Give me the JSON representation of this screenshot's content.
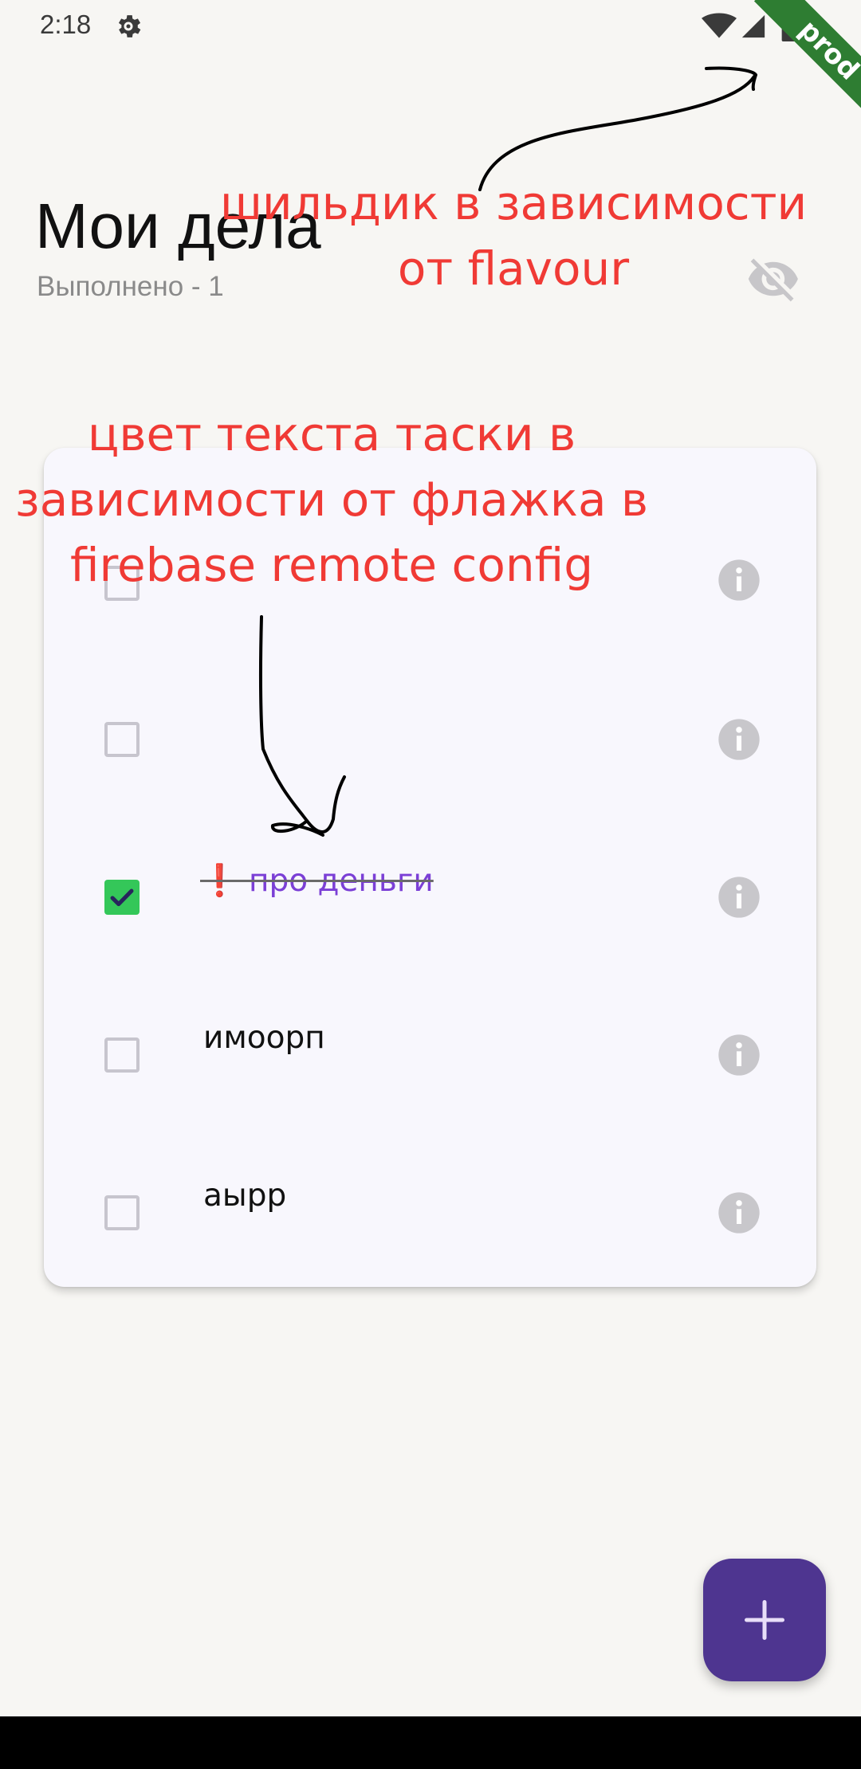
{
  "status_bar": {
    "time": "2:18",
    "icons": [
      "settings-gear-icon",
      "wifi-icon",
      "cell-signal-icon",
      "battery-icon"
    ]
  },
  "banner": {
    "label": "prod",
    "color": "#2E7D32"
  },
  "header": {
    "title": "Мои дела",
    "done_counter": "Выполнено - 1",
    "visibility_icon": "visibility-off-icon"
  },
  "tasks": [
    {
      "text": "",
      "done": false,
      "info_icon": "info-icon"
    },
    {
      "text": "",
      "done": false,
      "info_icon": "info-icon"
    },
    {
      "text": "❗ про деньги",
      "done": true,
      "info_icon": "info-icon"
    },
    {
      "text": "имоорп",
      "done": false,
      "info_icon": "info-icon"
    },
    {
      "text": "аырр",
      "done": false,
      "info_icon": "info-icon"
    }
  ],
  "fab": {
    "icon": "plus-icon",
    "color": "#4E3590"
  },
  "annotations": {
    "flavour": [
      "шильдик в зависимости",
      "от flavour"
    ],
    "config": [
      "цвет текста таски в",
      "зависимости от флажка в",
      "firebase remote config"
    ],
    "color": "#F03A35"
  },
  "colors": {
    "background": "#F7F6F3",
    "card": "#F8F7FD",
    "checkbox_checked": "#34C759",
    "done_text": "#7B3FD6"
  }
}
